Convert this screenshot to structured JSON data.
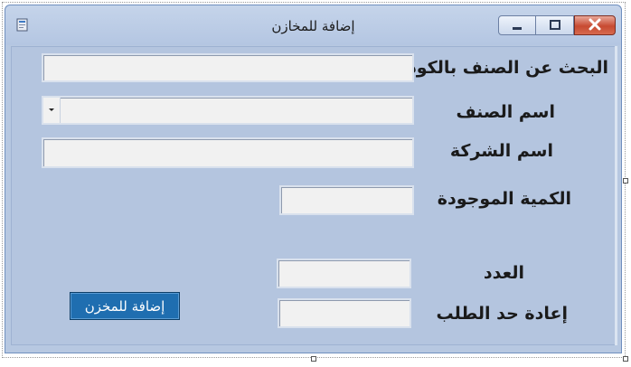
{
  "window": {
    "title": "إضافة للمخازن",
    "icon": "app-form-icon",
    "controls": [
      "minimize-icon",
      "maximize-icon",
      "close-icon"
    ]
  },
  "form": {
    "search_label": "البحث عن الصنف بالكود",
    "search_value": "",
    "item_name_label": "اسم الصنف",
    "item_name_value": "",
    "company_label": "اسم الشركة",
    "company_value": "",
    "current_qty_label": "الكمية الموجودة",
    "current_qty_value": "",
    "count_label": "العدد",
    "count_value": "",
    "reorder_label": "إعادة حد الطلب",
    "reorder_value": "",
    "add_button_label": "إضافة للمخزن"
  },
  "colors": {
    "form_background": "#b4c5df",
    "button_background": "#1f6eb0",
    "close_button": "#c74a31"
  }
}
